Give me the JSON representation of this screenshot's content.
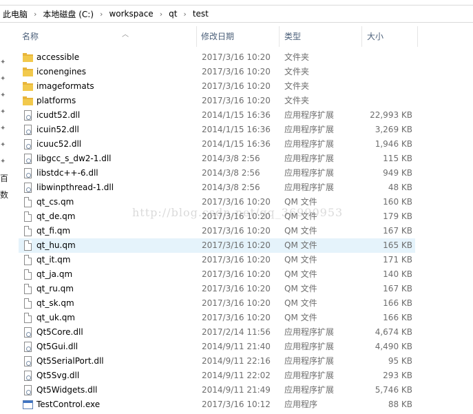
{
  "breadcrumb": [
    "此电脑",
    "本地磁盘 (C:)",
    "workspace",
    "qt",
    "test"
  ],
  "columns": {
    "name": "名称",
    "date": "修改日期",
    "type": "类型",
    "size": "大小"
  },
  "nav_pane": {
    "text1": "百",
    "text2": "数"
  },
  "watermark": "http://blog.csdn.net/qq_36990953",
  "files": [
    {
      "name": "accessible",
      "date": "2017/3/16 10:20",
      "type": "文件夹",
      "size": "",
      "icon": "folder-icon"
    },
    {
      "name": "iconengines",
      "date": "2017/3/16 10:20",
      "type": "文件夹",
      "size": "",
      "icon": "folder-icon"
    },
    {
      "name": "imageformats",
      "date": "2017/3/16 10:20",
      "type": "文件夹",
      "size": "",
      "icon": "folder-icon"
    },
    {
      "name": "platforms",
      "date": "2017/3/16 10:20",
      "type": "文件夹",
      "size": "",
      "icon": "folder-icon"
    },
    {
      "name": "icudt52.dll",
      "date": "2014/1/15 16:36",
      "type": "应用程序扩展",
      "size": "22,993 KB",
      "icon": "dll-icon"
    },
    {
      "name": "icuin52.dll",
      "date": "2014/1/15 16:36",
      "type": "应用程序扩展",
      "size": "3,269 KB",
      "icon": "dll-icon"
    },
    {
      "name": "icuuc52.dll",
      "date": "2014/1/15 16:36",
      "type": "应用程序扩展",
      "size": "1,946 KB",
      "icon": "dll-icon"
    },
    {
      "name": "libgcc_s_dw2-1.dll",
      "date": "2014/3/8 2:56",
      "type": "应用程序扩展",
      "size": "115 KB",
      "icon": "dll-icon"
    },
    {
      "name": "libstdc++-6.dll",
      "date": "2014/3/8 2:56",
      "type": "应用程序扩展",
      "size": "949 KB",
      "icon": "dll-icon"
    },
    {
      "name": "libwinpthread-1.dll",
      "date": "2014/3/8 2:56",
      "type": "应用程序扩展",
      "size": "48 KB",
      "icon": "dll-icon"
    },
    {
      "name": "qt_cs.qm",
      "date": "2017/3/16 10:20",
      "type": "QM 文件",
      "size": "160 KB",
      "icon": "file-icon"
    },
    {
      "name": "qt_de.qm",
      "date": "2017/3/16 10:20",
      "type": "QM 文件",
      "size": "179 KB",
      "icon": "file-icon"
    },
    {
      "name": "qt_fi.qm",
      "date": "2017/3/16 10:20",
      "type": "QM 文件",
      "size": "167 KB",
      "icon": "file-icon"
    },
    {
      "name": "qt_hu.qm",
      "date": "2017/3/16 10:20",
      "type": "QM 文件",
      "size": "165 KB",
      "icon": "file-icon",
      "selected": true
    },
    {
      "name": "qt_it.qm",
      "date": "2017/3/16 10:20",
      "type": "QM 文件",
      "size": "171 KB",
      "icon": "file-icon"
    },
    {
      "name": "qt_ja.qm",
      "date": "2017/3/16 10:20",
      "type": "QM 文件",
      "size": "140 KB",
      "icon": "file-icon"
    },
    {
      "name": "qt_ru.qm",
      "date": "2017/3/16 10:20",
      "type": "QM 文件",
      "size": "167 KB",
      "icon": "file-icon"
    },
    {
      "name": "qt_sk.qm",
      "date": "2017/3/16 10:20",
      "type": "QM 文件",
      "size": "166 KB",
      "icon": "file-icon"
    },
    {
      "name": "qt_uk.qm",
      "date": "2017/3/16 10:20",
      "type": "QM 文件",
      "size": "166 KB",
      "icon": "file-icon"
    },
    {
      "name": "Qt5Core.dll",
      "date": "2017/2/14 11:56",
      "type": "应用程序扩展",
      "size": "4,674 KB",
      "icon": "dll-icon"
    },
    {
      "name": "Qt5Gui.dll",
      "date": "2014/9/11 21:40",
      "type": "应用程序扩展",
      "size": "4,490 KB",
      "icon": "dll-icon"
    },
    {
      "name": "Qt5SerialPort.dll",
      "date": "2014/9/11 22:16",
      "type": "应用程序扩展",
      "size": "95 KB",
      "icon": "dll-icon"
    },
    {
      "name": "Qt5Svg.dll",
      "date": "2014/9/11 22:02",
      "type": "应用程序扩展",
      "size": "293 KB",
      "icon": "dll-icon"
    },
    {
      "name": "Qt5Widgets.dll",
      "date": "2014/9/11 21:49",
      "type": "应用程序扩展",
      "size": "5,746 KB",
      "icon": "dll-icon"
    },
    {
      "name": "TestControl.exe",
      "date": "2017/3/16 10:12",
      "type": "应用程序",
      "size": "88 KB",
      "icon": "exe-icon"
    }
  ]
}
